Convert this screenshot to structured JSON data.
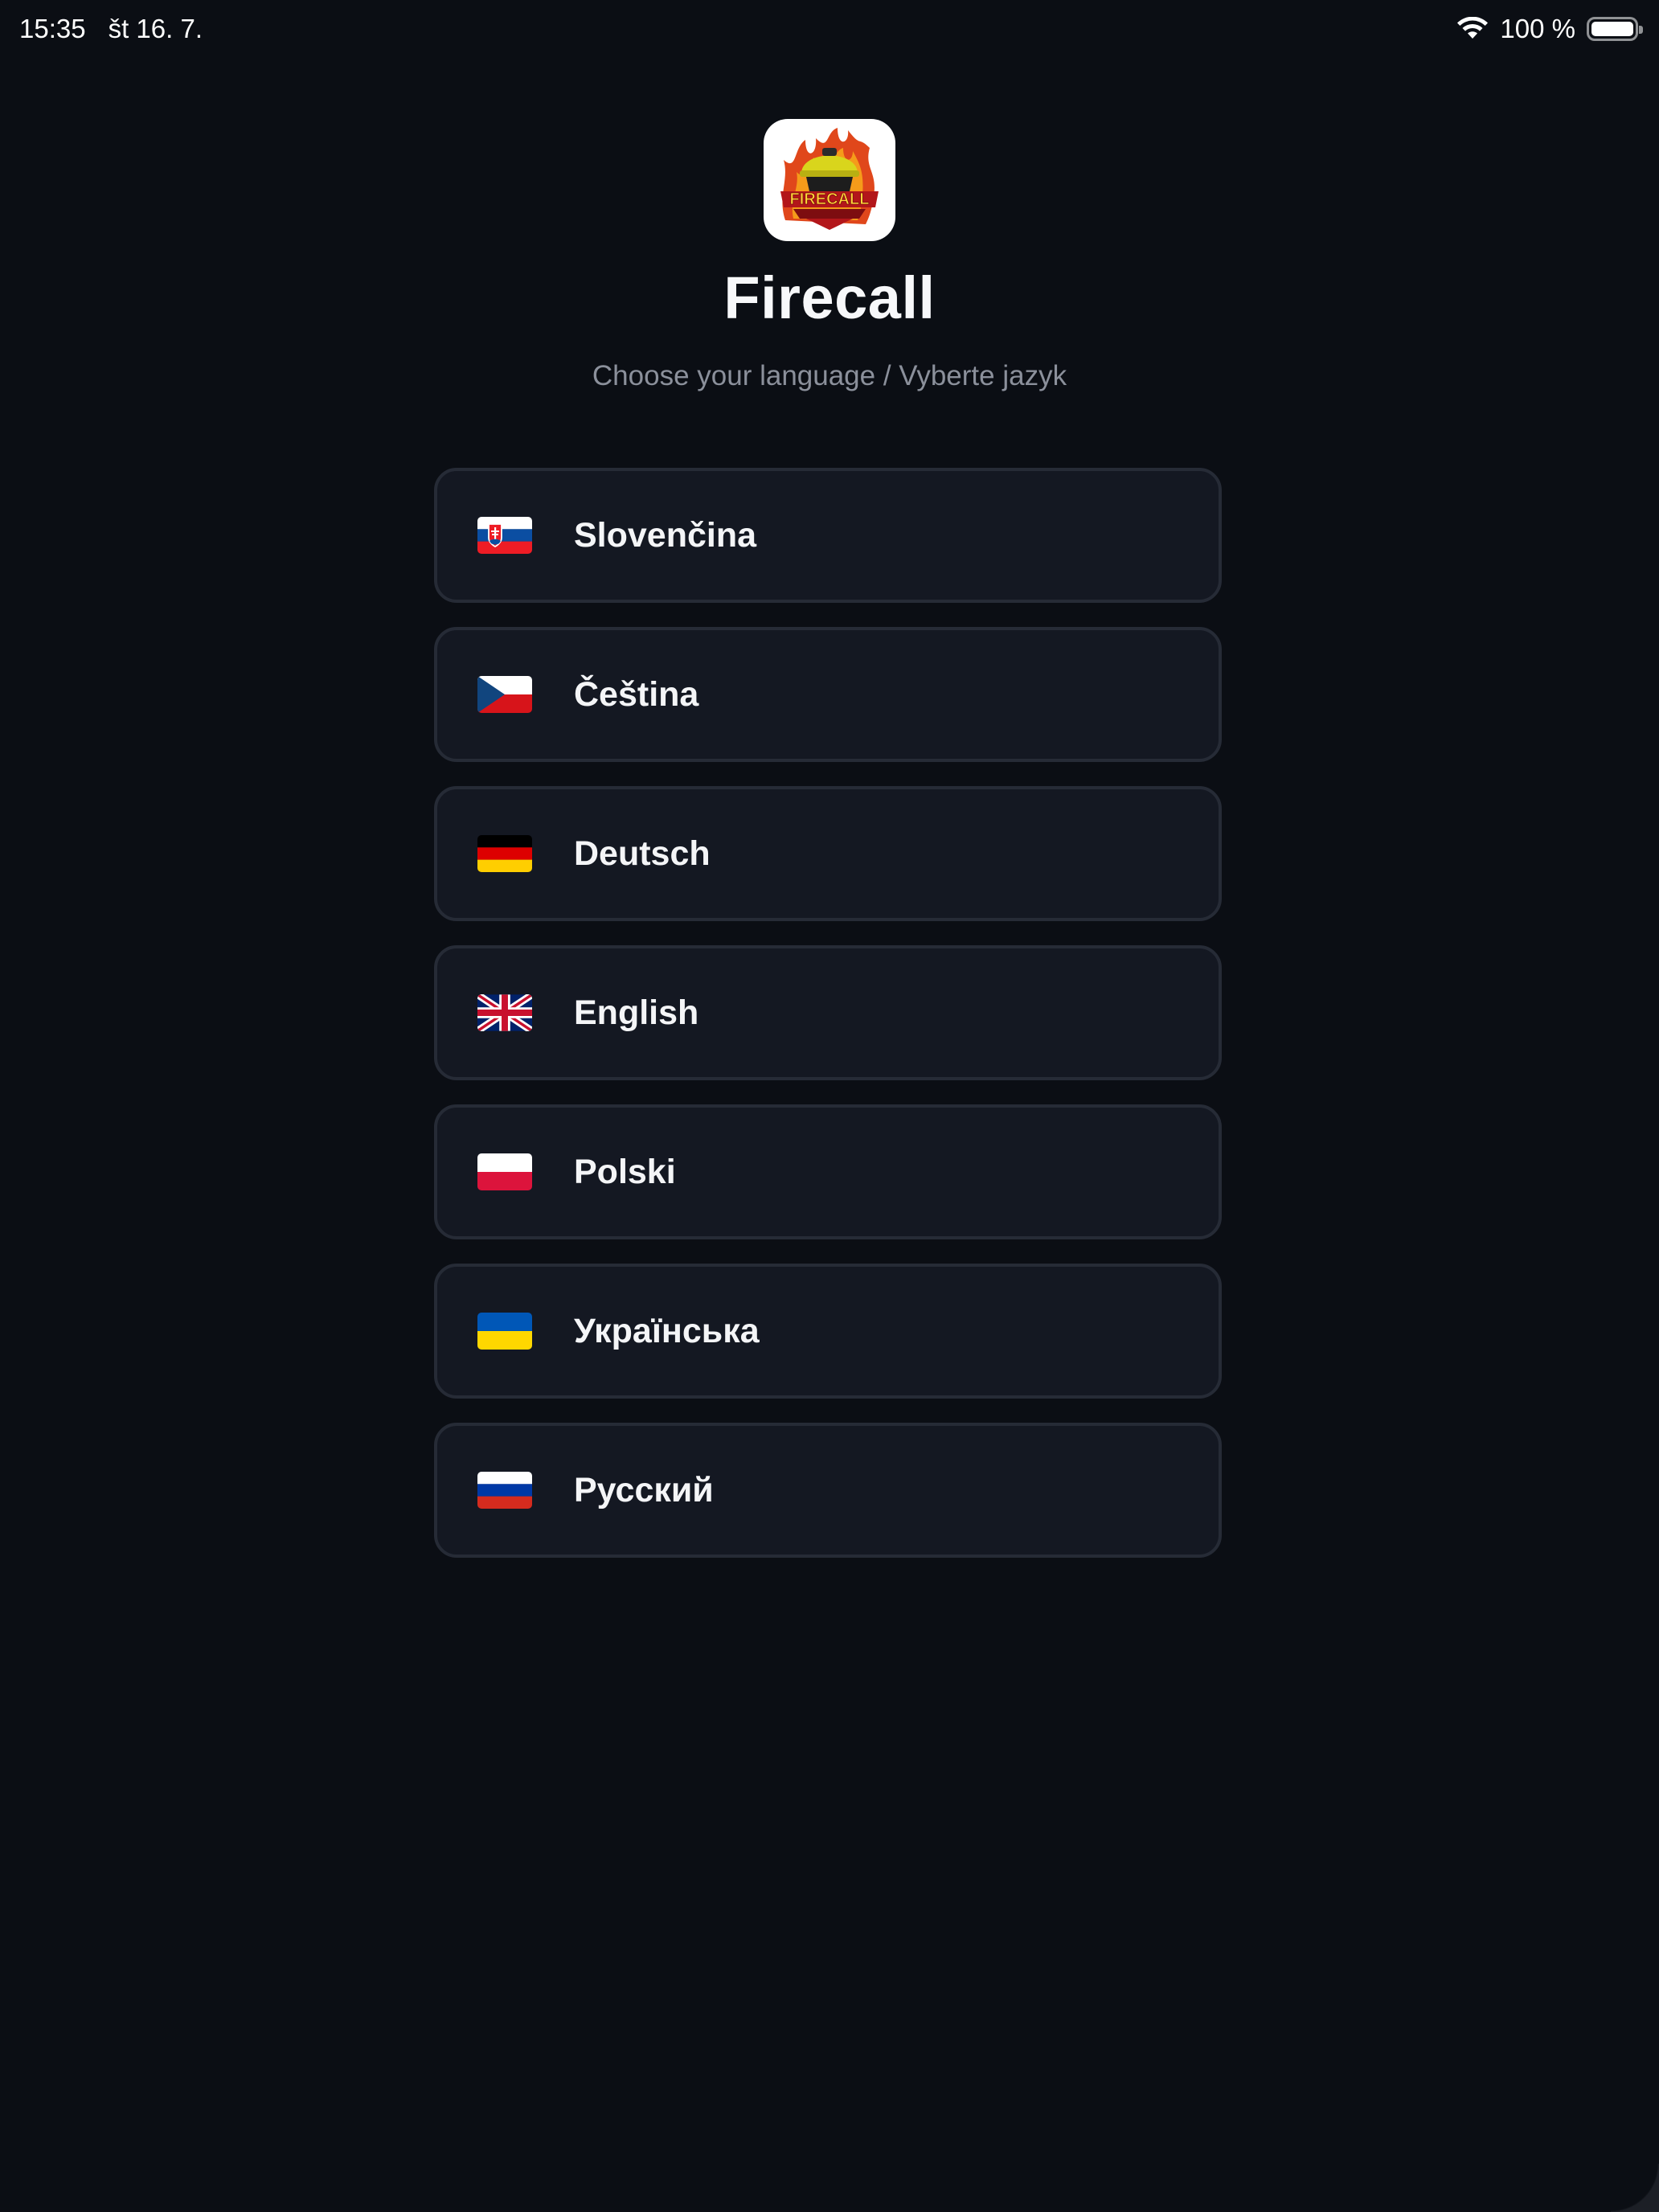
{
  "status_bar": {
    "time": "15:35",
    "date": "št 16. 7.",
    "battery": "100 %",
    "icons": [
      "wifi-icon",
      "battery-icon"
    ]
  },
  "header": {
    "logo_icon": "firecall-logo",
    "title": "Firecall",
    "subtitle": "Choose your language / Vyberte jazyk"
  },
  "languages": [
    {
      "label": "Slovenčina",
      "flag": "flag-sk-icon"
    },
    {
      "label": "Čeština",
      "flag": "flag-cz-icon"
    },
    {
      "label": "Deutsch",
      "flag": "flag-de-icon"
    },
    {
      "label": "English",
      "flag": "flag-gb-icon"
    },
    {
      "label": "Polski",
      "flag": "flag-pl-icon"
    },
    {
      "label": "Українська",
      "flag": "flag-ua-icon"
    },
    {
      "label": "Русский",
      "flag": "flag-ru-icon"
    }
  ],
  "colors": {
    "background": "#0b0e14",
    "card": "#141822",
    "card_border": "#262b36",
    "subtitle": "#8b909b"
  }
}
